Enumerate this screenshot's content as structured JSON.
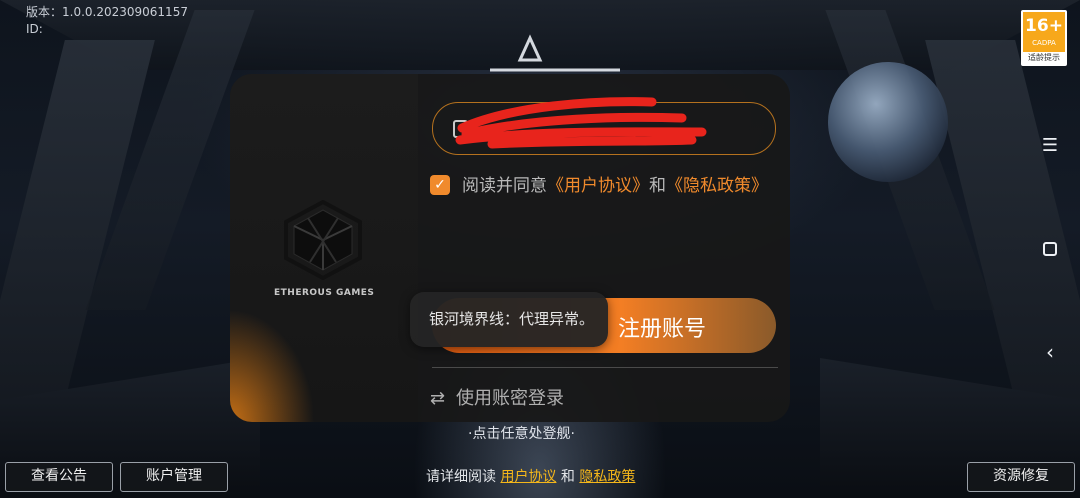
{
  "version": {
    "label": "版本：1.0.0.202309061157",
    "id_label": "ID:"
  },
  "age_rating": {
    "value": "16+",
    "org": "CADPA",
    "tip": "适龄提示"
  },
  "card": {
    "brand_name": "ETHEROUS GAMES",
    "account_value": "",
    "agree": {
      "checked": true,
      "prefix": "阅读并同意",
      "user_agreement": "《用户协议》",
      "and": "和",
      "privacy_policy": "《隐私政策》"
    },
    "register_label": "注册账号",
    "toast_text": "银河境界线：代理异常。",
    "password_login_label": "使用账密登录"
  },
  "tap_hint": "·点击任意处登舰·",
  "bottom": {
    "notice_label": "查看公告",
    "account_manage_label": "账户管理",
    "repair_label": "资源修复",
    "footer": {
      "prefix": "请详细阅读",
      "user_agreement": "用户协议",
      "and": "和",
      "privacy_policy": "隐私政策"
    }
  },
  "colors": {
    "accent": "#f08a2c",
    "footer_link": "#f5b71a",
    "age_badge": "#f7a81b"
  },
  "icons": {
    "nav_menu": "menu-icon",
    "nav_home": "square-home-icon",
    "nav_back": "chevron-left-icon",
    "switch": "swap-arrows-icon",
    "checkbox": "checkmark-icon"
  }
}
